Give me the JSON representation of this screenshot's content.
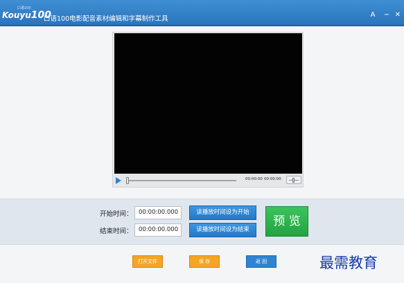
{
  "header": {
    "logo_text": "Kouyu",
    "logo_number": "100",
    "logo_superscript": "口语100",
    "title": "口语100电影配音素材编辑和字幕制作工具",
    "user_glyph": "A",
    "minimize_glyph": "−",
    "close_glyph": "✕"
  },
  "player": {
    "current_time": "00:00:00",
    "total_time": "00:00:00",
    "progress": 0
  },
  "clip": {
    "start_label": "开始时间：",
    "start_value": "00:00:00.000",
    "end_label": "结束时间：",
    "end_value": "00:00:00.000",
    "set_start_label": "读播放时间设为开始",
    "set_end_label": "读播放时间设为结束",
    "preview_label": "预 览"
  },
  "actions": {
    "open_label": "打开文件",
    "save_label": "保 存",
    "back_label": "返 回"
  },
  "watermark": "最需教育",
  "colors": {
    "titlebar": "#2f80cc",
    "blue_button": "#2a7fcf",
    "preview_button": "#2db34f",
    "orange_button": "#f5a524",
    "watermark": "#173aa6"
  }
}
